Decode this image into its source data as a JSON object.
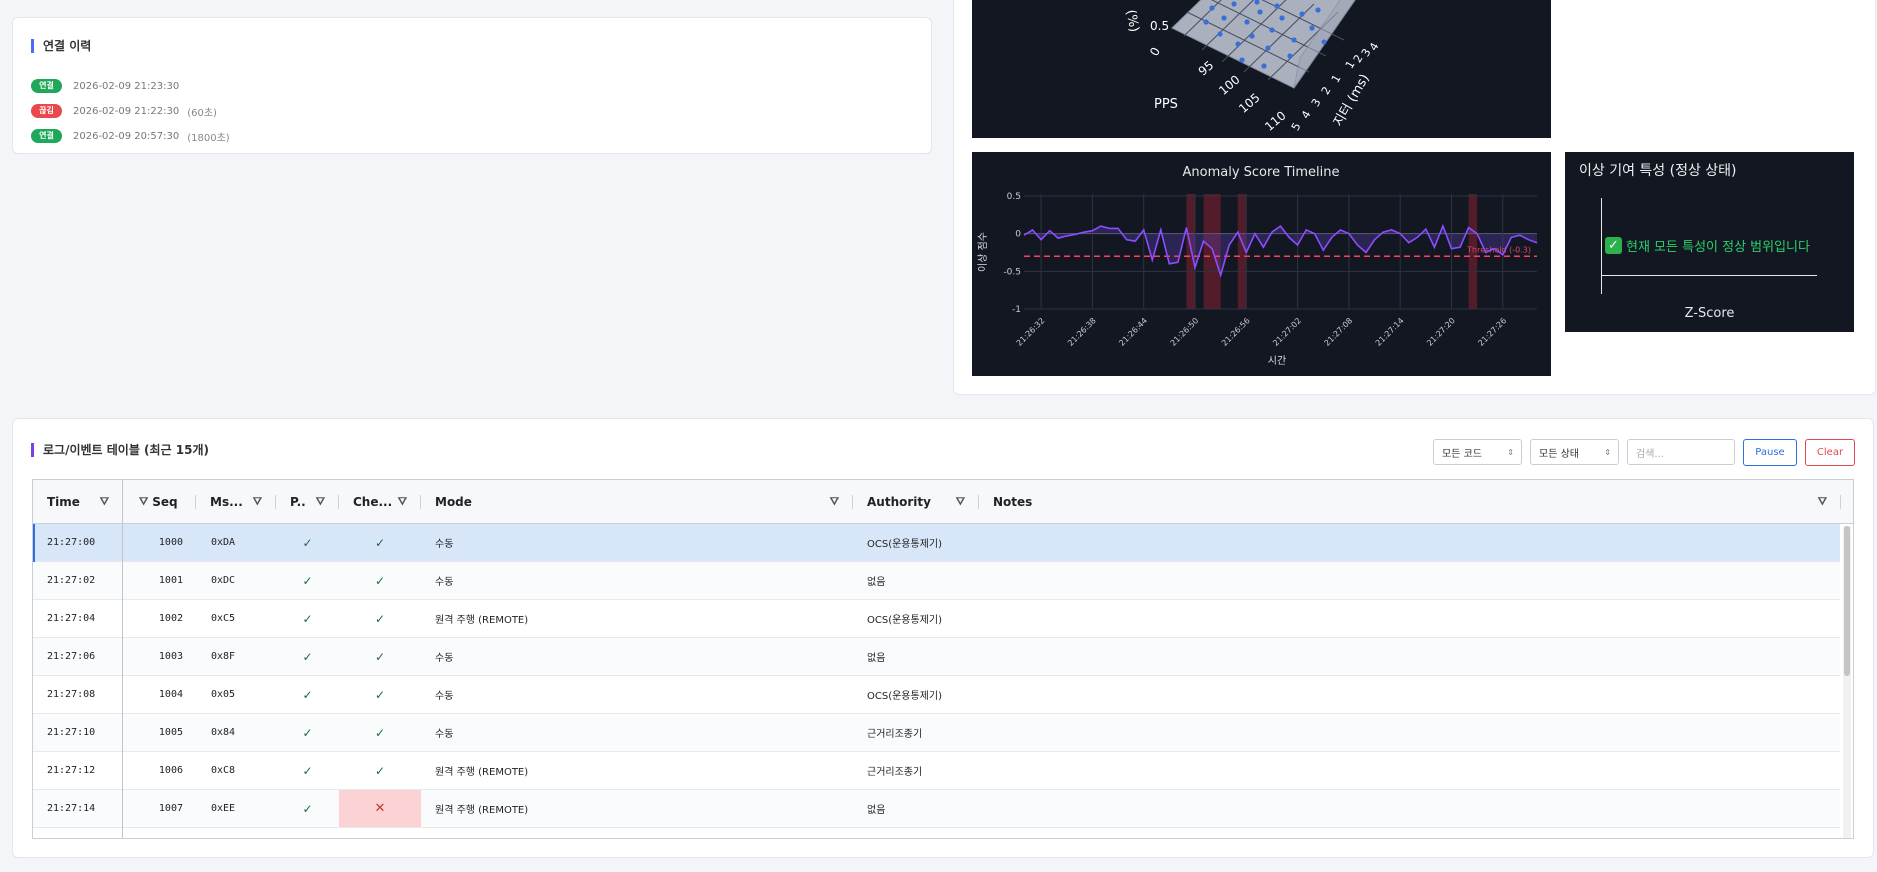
{
  "connection_history": {
    "title": "연결 이력",
    "entries": [
      {
        "status": "연결",
        "color": "#1fa85a",
        "time": "2026-02-09 21:23:30",
        "duration": ""
      },
      {
        "status": "끊김",
        "color": "#e8484e",
        "time": "2026-02-09 21:22:30",
        "duration": "(60초)"
      },
      {
        "status": "연결",
        "color": "#1fa85a",
        "time": "2026-02-09 20:57:30",
        "duration": "(1800초)"
      }
    ]
  },
  "plot3d": {
    "y_axis_title": "PPS",
    "x_axis_title": "지터 (ms)",
    "z_axis_title_partial": "(%)",
    "pps_ticks": [
      "95",
      "100",
      "105",
      "110"
    ],
    "jitter_ticks": [
      "1",
      "2",
      "3",
      "4",
      "5"
    ],
    "z_ticks": [
      "0.5",
      "0"
    ],
    "jitter_ticks_upper": [
      "1",
      "2",
      "3",
      "4"
    ]
  },
  "chart_data": {
    "type": "line",
    "title": "Anomaly Score Timeline",
    "xlabel": "시간",
    "ylabel": "이상 점수",
    "ylim": [
      -1,
      0.5
    ],
    "y_ticks": [
      "0.5",
      "0",
      "-0.5",
      "-1"
    ],
    "x_ticks": [
      "21:26:32",
      "21:26:38",
      "21:26:44",
      "21:26:50",
      "21:26:56",
      "21:27:02",
      "21:27:08",
      "21:27:14",
      "21:27:20",
      "21:27:26"
    ],
    "threshold": {
      "value": -0.3,
      "label": "Threshold (-0.3)"
    },
    "anomaly_windows": [
      [
        "21:26:51",
        "21:26:52"
      ],
      [
        "21:26:53",
        "21:26:55"
      ],
      [
        "21:26:57",
        "21:26:58"
      ],
      [
        "21:27:24",
        "21:27:25"
      ]
    ],
    "series": [
      {
        "x_seconds_from_start": [
          0,
          1,
          2,
          3,
          4,
          5,
          6,
          7,
          8,
          9,
          10,
          11,
          12,
          13,
          14,
          15,
          16,
          17,
          18,
          19,
          20,
          21,
          22,
          23,
          24,
          25,
          26,
          27,
          28,
          29,
          30,
          31,
          32,
          33,
          34,
          35,
          36,
          37,
          38,
          39,
          40,
          41,
          42,
          43,
          44,
          45,
          46,
          47,
          48,
          49,
          50,
          51,
          52,
          53,
          54,
          55,
          56,
          57,
          58,
          59,
          60
        ],
        "values": [
          -0.02,
          0.05,
          -0.08,
          0.04,
          -0.06,
          -0.03,
          -0.01,
          0.02,
          0.04,
          0.1,
          0.07,
          0.07,
          -0.08,
          -0.1,
          0.05,
          -0.35,
          0.05,
          -0.4,
          -0.38,
          0.08,
          -0.45,
          -0.1,
          -0.2,
          -0.55,
          -0.15,
          0.02,
          -0.25,
          0.0,
          -0.18,
          0.02,
          0.1,
          -0.05,
          -0.15,
          0.05,
          0.0,
          -0.22,
          -0.05,
          0.05,
          0.0,
          -0.15,
          -0.25,
          -0.08,
          0.02,
          0.05,
          0.0,
          -0.12,
          -0.05,
          0.06,
          -0.18,
          0.1,
          -0.2,
          -0.18,
          0.08,
          0.0,
          -0.25,
          -0.2,
          -0.28,
          -0.05,
          -0.02,
          -0.08,
          -0.12
        ]
      }
    ]
  },
  "contribution": {
    "title": "이상 기여 특성 (정상 상태)",
    "message": "현재 모든 특성이 정상 범위입니다",
    "xlabel": "Z-Score"
  },
  "log_table": {
    "title": "로그/이벤트 테이블 (최근 15개)",
    "code_filter": "모든 코드",
    "status_filter": "모든 상태",
    "search_placeholder": "검색...",
    "pause_label": "Pause",
    "clear_label": "Clear",
    "columns": [
      "Time",
      "Seq",
      "Ms...",
      "P..",
      "Che...",
      "Mode",
      "Authority",
      "Notes"
    ],
    "rows": [
      {
        "time": "21:27:00",
        "seq": "1000",
        "msg": "0xDA",
        "p": "✓",
        "check": "✓",
        "check_ok": true,
        "mode": "수동",
        "authority": "OCS(운용통제기)",
        "notes": ""
      },
      {
        "time": "21:27:02",
        "seq": "1001",
        "msg": "0xDC",
        "p": "✓",
        "check": "✓",
        "check_ok": true,
        "mode": "수동",
        "authority": "없음",
        "notes": ""
      },
      {
        "time": "21:27:04",
        "seq": "1002",
        "msg": "0xC5",
        "p": "✓",
        "check": "✓",
        "check_ok": true,
        "mode": "원격 주행 (REMOTE)",
        "authority": "OCS(운용통제기)",
        "notes": ""
      },
      {
        "time": "21:27:06",
        "seq": "1003",
        "msg": "0x8F",
        "p": "✓",
        "check": "✓",
        "check_ok": true,
        "mode": "수동",
        "authority": "없음",
        "notes": ""
      },
      {
        "time": "21:27:08",
        "seq": "1004",
        "msg": "0x05",
        "p": "✓",
        "check": "✓",
        "check_ok": true,
        "mode": "수동",
        "authority": "OCS(운용통제기)",
        "notes": ""
      },
      {
        "time": "21:27:10",
        "seq": "1005",
        "msg": "0x84",
        "p": "✓",
        "check": "✓",
        "check_ok": true,
        "mode": "수동",
        "authority": "근거리조종기",
        "notes": ""
      },
      {
        "time": "21:27:12",
        "seq": "1006",
        "msg": "0xC8",
        "p": "✓",
        "check": "✓",
        "check_ok": true,
        "mode": "원격 주행 (REMOTE)",
        "authority": "근거리조종기",
        "notes": ""
      },
      {
        "time": "21:27:14",
        "seq": "1007",
        "msg": "0xEE",
        "p": "✓",
        "check": "✕",
        "check_ok": false,
        "mode": "원격 주행 (REMOTE)",
        "authority": "없음",
        "notes": ""
      }
    ]
  }
}
